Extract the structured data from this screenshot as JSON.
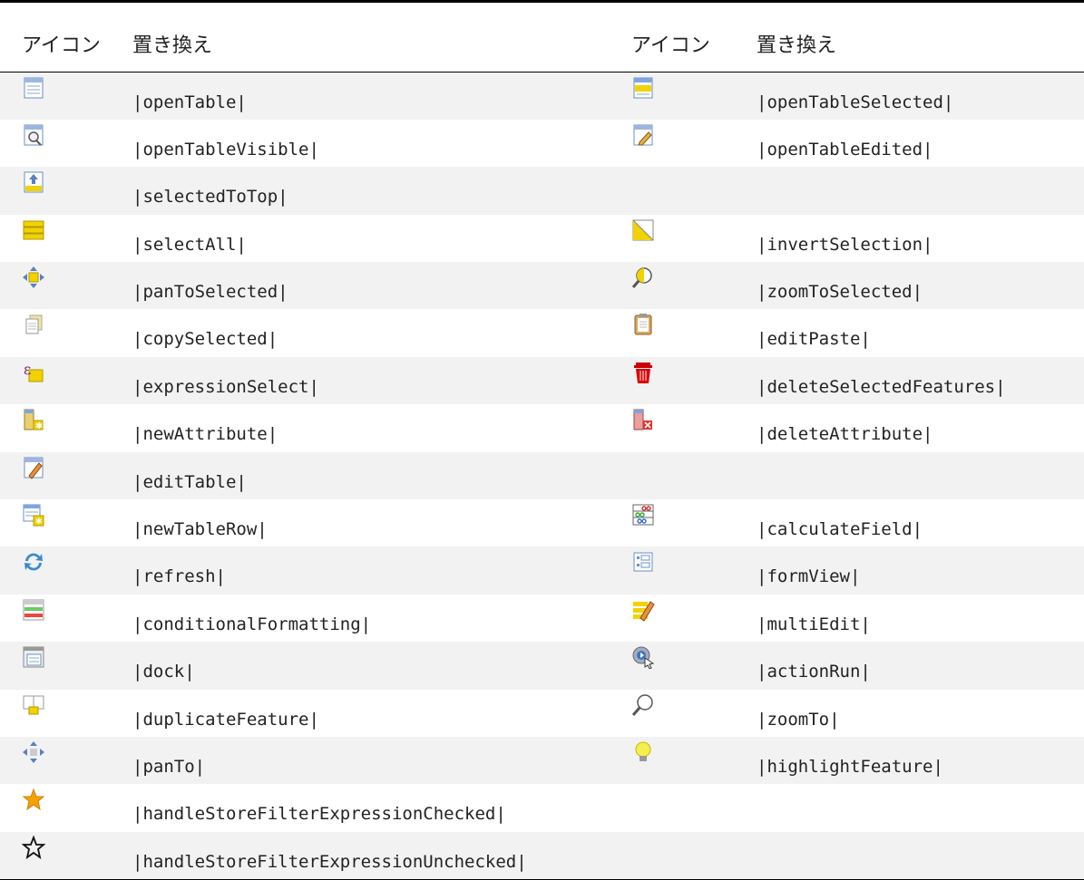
{
  "header": {
    "icon_label_left": "アイコン",
    "replacement_label_left": "置き換え",
    "icon_label_right": "アイコン",
    "replacement_label_right": "置き換え"
  },
  "rows": [
    {
      "left_icon": "open-table-icon",
      "left_text": "|openTable|",
      "right_icon": "open-table-selected-icon",
      "right_text": "|openTableSelected|"
    },
    {
      "left_icon": "open-table-visible-icon",
      "left_text": "|openTableVisible|",
      "right_icon": "open-table-edited-icon",
      "right_text": "|openTableEdited|"
    },
    {
      "left_icon": "selected-to-top-icon",
      "left_text": "|selectedToTop|",
      "right_icon": "",
      "right_text": ""
    },
    {
      "left_icon": "select-all-icon",
      "left_text": "|selectAll|",
      "right_icon": "invert-selection-icon",
      "right_text": "|invertSelection|"
    },
    {
      "left_icon": "pan-to-selected-icon",
      "left_text": "|panToSelected|",
      "right_icon": "zoom-to-selected-icon",
      "right_text": "|zoomToSelected|"
    },
    {
      "left_icon": "copy-selected-icon",
      "left_text": "|copySelected|",
      "right_icon": "edit-paste-icon",
      "right_text": "|editPaste|"
    },
    {
      "left_icon": "expression-select-icon",
      "left_text": "|expressionSelect|",
      "right_icon": "delete-selected-features-icon",
      "right_text": "|deleteSelectedFeatures|"
    },
    {
      "left_icon": "new-attribute-icon",
      "left_text": "|newAttribute|",
      "right_icon": "delete-attribute-icon",
      "right_text": "|deleteAttribute|"
    },
    {
      "left_icon": "edit-table-icon",
      "left_text": "|editTable|",
      "right_icon": "",
      "right_text": ""
    },
    {
      "left_icon": "new-table-row-icon",
      "left_text": "|newTableRow|",
      "right_icon": "calculate-field-icon",
      "right_text": "|calculateField|"
    },
    {
      "left_icon": "refresh-icon",
      "left_text": "|refresh|",
      "right_icon": "form-view-icon",
      "right_text": "|formView|"
    },
    {
      "left_icon": "conditional-formatting-icon",
      "left_text": "|conditionalFormatting|",
      "right_icon": "multi-edit-icon",
      "right_text": "|multiEdit|"
    },
    {
      "left_icon": "dock-icon",
      "left_text": "|dock|",
      "right_icon": "action-run-icon",
      "right_text": "|actionRun|"
    },
    {
      "left_icon": "duplicate-feature-icon",
      "left_text": "|duplicateFeature|",
      "right_icon": "zoom-to-icon",
      "right_text": "|zoomTo|"
    },
    {
      "left_icon": "pan-to-icon",
      "left_text": "|panTo|",
      "right_icon": "highlight-feature-icon",
      "right_text": "|highlightFeature|"
    },
    {
      "left_icon": "star-filled-icon",
      "left_text": "|handleStoreFilterExpressionChecked|",
      "right_icon": "",
      "right_text": ""
    },
    {
      "left_icon": "star-outline-icon",
      "left_text": "|handleStoreFilterExpressionUnchecked|",
      "right_icon": "",
      "right_text": ""
    }
  ]
}
